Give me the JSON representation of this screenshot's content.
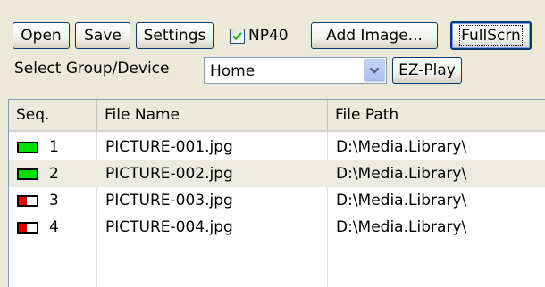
{
  "toolbar": {
    "open_label": "Open",
    "save_label": "Save",
    "settings_label": "Settings",
    "np40_label": "NP40",
    "np40_checked": true,
    "add_image_label": "Add Image...",
    "fullscrn_label": "FullScrn"
  },
  "group_select": {
    "label": "Select Group/Device",
    "value": "Home",
    "ezplay_label": "EZ-Play"
  },
  "table": {
    "columns": [
      "Seq.",
      "File Name",
      "File Path"
    ],
    "rows": [
      {
        "seq": "1",
        "name": "PICTURE-001.jpg",
        "path": "D:\\Media.Library\\",
        "status": "green"
      },
      {
        "seq": "2",
        "name": "PICTURE-002.jpg",
        "path": "D:\\Media.Library\\",
        "status": "green"
      },
      {
        "seq": "3",
        "name": "PICTURE-003.jpg",
        "path": "D:\\Media.Library\\",
        "status": "red"
      },
      {
        "seq": "4",
        "name": "PICTURE-004.jpg",
        "path": "D:\\Media.Library\\",
        "status": "red"
      }
    ]
  },
  "colors": {
    "green_led": "#00e000",
    "red_led": "#e00000",
    "selected_row": "#ecebe0",
    "window_bg": "#ece9d8"
  }
}
